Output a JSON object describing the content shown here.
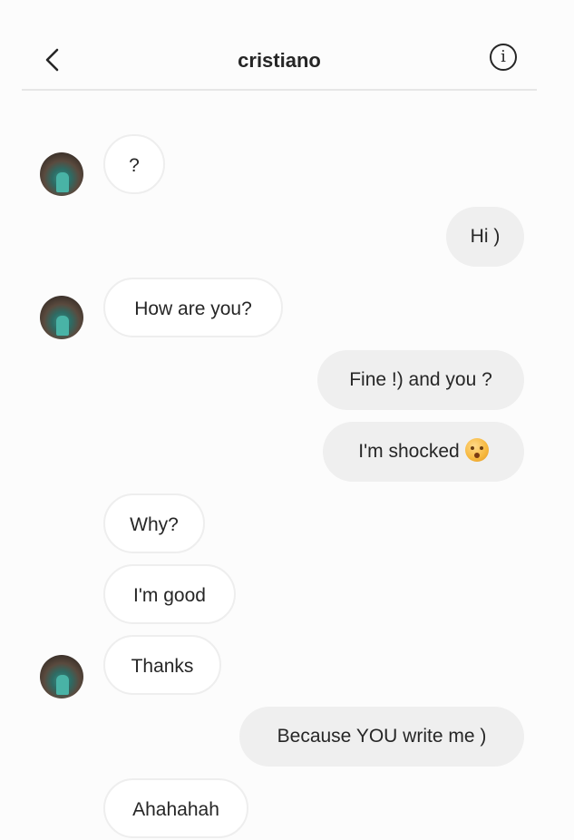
{
  "header": {
    "title": "cristiano",
    "back_icon": "chevron-left-icon",
    "info_icon": "info-icon",
    "info_glyph": "i"
  },
  "messages": [
    {
      "direction": "in",
      "text": "?",
      "has_avatar": true
    },
    {
      "direction": "out",
      "text": "Hi )"
    },
    {
      "direction": "in",
      "text": "How are you?",
      "has_avatar": true
    },
    {
      "direction": "out",
      "text": "Fine !) and you ?"
    },
    {
      "direction": "out",
      "text": "I'm shocked",
      "emoji": "flushed-face-icon"
    },
    {
      "direction": "in",
      "text": "Why?"
    },
    {
      "direction": "in",
      "text": "I'm good"
    },
    {
      "direction": "in",
      "text": "Thanks",
      "has_avatar": true
    },
    {
      "direction": "out",
      "text": "Because YOU write me )"
    },
    {
      "direction": "in",
      "text": "Ahahahah"
    }
  ]
}
